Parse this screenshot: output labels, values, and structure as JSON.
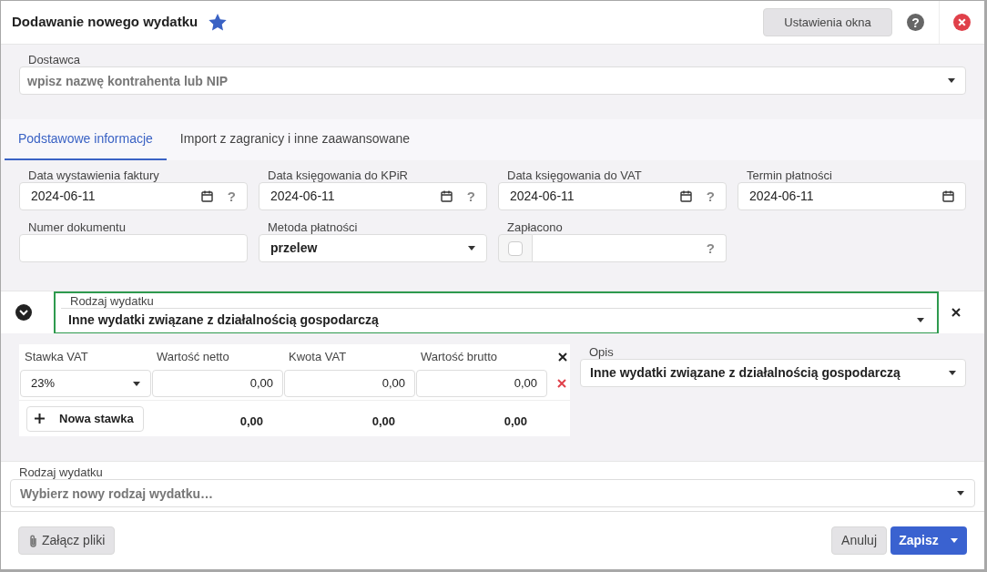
{
  "window": {
    "title": "Dodawanie nowego wydatku",
    "favorite": true
  },
  "header": {
    "settings_button": "Ustawienia okna",
    "help_icon": "?"
  },
  "supplier": {
    "label": "Dostawca",
    "placeholder": "wpisz nazwę kontrahenta lub NIP"
  },
  "tabs": [
    {
      "label": "Podstawowe informacje",
      "selected": true
    },
    {
      "label": "Import z zagranicy i inne zaawansowane",
      "selected": false
    }
  ],
  "fields": [
    {
      "kind": "date",
      "label": "Data wystawienia faktury",
      "value": "2024-06-11",
      "help": "?"
    },
    {
      "kind": "date",
      "label": "Data księgowania do KPiR",
      "value": "2024-06-11",
      "help": "?"
    },
    {
      "kind": "date",
      "label": "Data księgowania do VAT",
      "value": "2024-06-11",
      "help": "?"
    },
    {
      "kind": "date",
      "label": "Termin płatności",
      "value": "2024-06-11"
    },
    {
      "kind": "text",
      "label": "Numer dokumentu"
    },
    {
      "kind": "select",
      "label": "Metoda płatności",
      "value": "przelew"
    },
    {
      "kind": "checkbox",
      "label": "Zapłacono",
      "checked": false,
      "help": "?"
    }
  ],
  "expense": {
    "label": "Rodzaj wydatku",
    "value": "Inne wydatki związane z działalnością gospodarczą",
    "expanded": true
  },
  "vat_table": {
    "columns": [
      "Stawka VAT",
      "Wartość netto",
      "Kwota VAT",
      "Wartość brutto"
    ],
    "rows": [
      {
        "rate": "23%",
        "net": "0,00",
        "vat": "0,00",
        "gross": "0,00"
      }
    ],
    "add_button": "Nowa stawka",
    "totals": [
      "0,00",
      "0,00",
      "0,00"
    ]
  },
  "description": {
    "label": "Opis",
    "value": "Inne wydatki związane z działalnością gospodarczą"
  },
  "new_expense": {
    "label": "Rodzaj wydatku",
    "placeholder": "Wybierz nowy rodzaj wydatku…"
  },
  "footer": {
    "attach_button": "Załącz pliki",
    "cancel_button": "Anuluj",
    "save_button": "Zapisz"
  }
}
